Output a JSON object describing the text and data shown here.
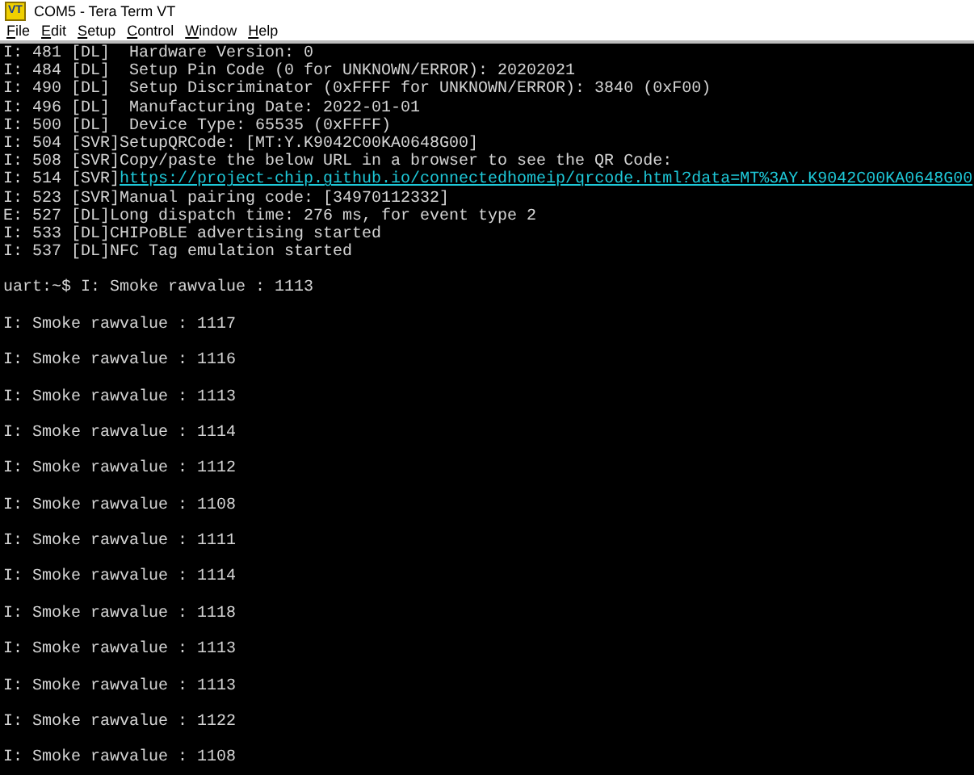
{
  "window": {
    "title": "COM5 - Tera Term VT",
    "app_icon_text": "VT"
  },
  "menu": [
    "File",
    "Edit",
    "Setup",
    "Control",
    "Window",
    "Help"
  ],
  "terminal_lines": [
    {
      "kind": "log",
      "text": "I: 481 [DL]  Hardware Version: 0"
    },
    {
      "kind": "log",
      "text": "I: 484 [DL]  Setup Pin Code (0 for UNKNOWN/ERROR): 20202021"
    },
    {
      "kind": "log",
      "text": "I: 490 [DL]  Setup Discriminator (0xFFFF for UNKNOWN/ERROR): 3840 (0xF00)"
    },
    {
      "kind": "log",
      "text": "I: 496 [DL]  Manufacturing Date: 2022-01-01"
    },
    {
      "kind": "log",
      "text": "I: 500 [DL]  Device Type: 65535 (0xFFFF)"
    },
    {
      "kind": "log",
      "text": "I: 504 [SVR]SetupQRCode: [MT:Y.K9042C00KA0648G00]"
    },
    {
      "kind": "log",
      "text": "I: 508 [SVR]Copy/paste the below URL in a browser to see the QR Code:"
    },
    {
      "kind": "link",
      "text": "I: 514 [SVR]",
      "link": "https://project-chip.github.io/connectedhomeip/qrcode.html?data=MT%3AY.K9042C00KA0648G00"
    },
    {
      "kind": "log",
      "text": "I: 523 [SVR]Manual pairing code: [34970112332]"
    },
    {
      "kind": "log",
      "text": "E: 527 [DL]Long dispatch time: 276 ms, for event type 2"
    },
    {
      "kind": "log",
      "text": "I: 533 [DL]CHIPoBLE advertising started"
    },
    {
      "kind": "log",
      "text": "I: 537 [DL]NFC Tag emulation started"
    },
    {
      "kind": "blank"
    },
    {
      "kind": "log",
      "text": "uart:~$ I: Smoke rawvalue : 1113"
    },
    {
      "kind": "blank"
    },
    {
      "kind": "log",
      "text": "I: Smoke rawvalue : 1117"
    },
    {
      "kind": "blank"
    },
    {
      "kind": "log",
      "text": "I: Smoke rawvalue : 1116"
    },
    {
      "kind": "blank"
    },
    {
      "kind": "log",
      "text": "I: Smoke rawvalue : 1113"
    },
    {
      "kind": "blank"
    },
    {
      "kind": "log",
      "text": "I: Smoke rawvalue : 1114"
    },
    {
      "kind": "blank"
    },
    {
      "kind": "log",
      "text": "I: Smoke rawvalue : 1112"
    },
    {
      "kind": "blank"
    },
    {
      "kind": "log",
      "text": "I: Smoke rawvalue : 1108"
    },
    {
      "kind": "blank"
    },
    {
      "kind": "log",
      "text": "I: Smoke rawvalue : 1111"
    },
    {
      "kind": "blank"
    },
    {
      "kind": "log",
      "text": "I: Smoke rawvalue : 1114"
    },
    {
      "kind": "blank"
    },
    {
      "kind": "log",
      "text": "I: Smoke rawvalue : 1118"
    },
    {
      "kind": "blank"
    },
    {
      "kind": "log",
      "text": "I: Smoke rawvalue : 1113"
    },
    {
      "kind": "blank"
    },
    {
      "kind": "log",
      "text": "I: Smoke rawvalue : 1113"
    },
    {
      "kind": "blank"
    },
    {
      "kind": "log",
      "text": "I: Smoke rawvalue : 1122"
    },
    {
      "kind": "blank"
    },
    {
      "kind": "log",
      "text": "I: Smoke rawvalue : 1108"
    }
  ]
}
